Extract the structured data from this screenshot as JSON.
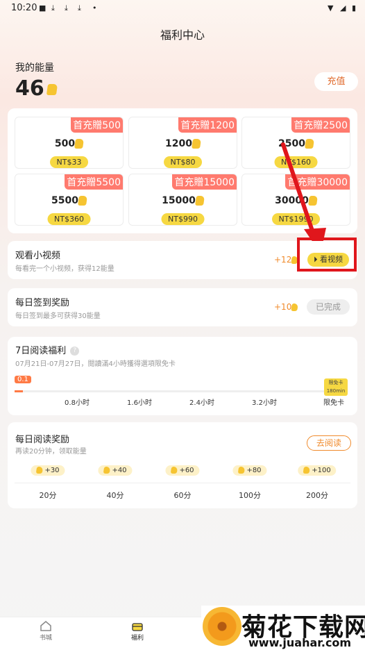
{
  "status": {
    "time": "10:20"
  },
  "header": {
    "title": "福利中心"
  },
  "energy": {
    "label": "我的能量",
    "value": "46",
    "recharge": "充值"
  },
  "packages": [
    {
      "badge": "首充贈500",
      "amount": "500",
      "price": "NT$33"
    },
    {
      "badge": "首充贈1200",
      "amount": "1200",
      "price": "NT$80"
    },
    {
      "badge": "首充贈2500",
      "amount": "2500",
      "price": "NT$160"
    },
    {
      "badge": "首充贈5500",
      "amount": "5500",
      "price": "NT$360"
    },
    {
      "badge": "首充贈15000",
      "amount": "15000",
      "price": "NT$990"
    },
    {
      "badge": "首充贈30000",
      "amount": "30000",
      "price": "NT$1990"
    }
  ],
  "tasks": {
    "video": {
      "name": "观看小视频",
      "desc": "每看完一个小视频，获得12能量",
      "reward": "+12",
      "button": "看视频"
    },
    "signin": {
      "name": "每日签到奖励",
      "desc": "每日签到最多可获得30能量",
      "reward": "+10",
      "button": "已完成"
    }
  },
  "read7": {
    "name": "7日阅读福利",
    "help": "?",
    "desc": "07月21日-07月27日，閱讀滿4小時獲得選項限免卡",
    "progress_label": "0.1",
    "progress_fraction": 0.025,
    "ticks": [
      "0.8小时",
      "1.6小时",
      "2.4小时",
      "3.2小时",
      "限免卡"
    ],
    "card_text": "限免卡",
    "card_sub": "180min"
  },
  "daily": {
    "name": "每日阅读奖励",
    "desc": "再读20分钟，领取能量",
    "button": "去阅读",
    "rewards": [
      "+30",
      "+40",
      "+60",
      "+80",
      "+100"
    ],
    "minutes": [
      "20分",
      "40分",
      "60分",
      "100分",
      "200分"
    ]
  },
  "tabbar": {
    "items": [
      "书城",
      "福利"
    ]
  },
  "watermark": {
    "title": "菊花下载网",
    "url": "www.juahar.com"
  },
  "colors": {
    "accent": "#f6d842",
    "badge": "#ff7a6e",
    "highlight": "#e0161c",
    "reward": "#f08a2b"
  }
}
